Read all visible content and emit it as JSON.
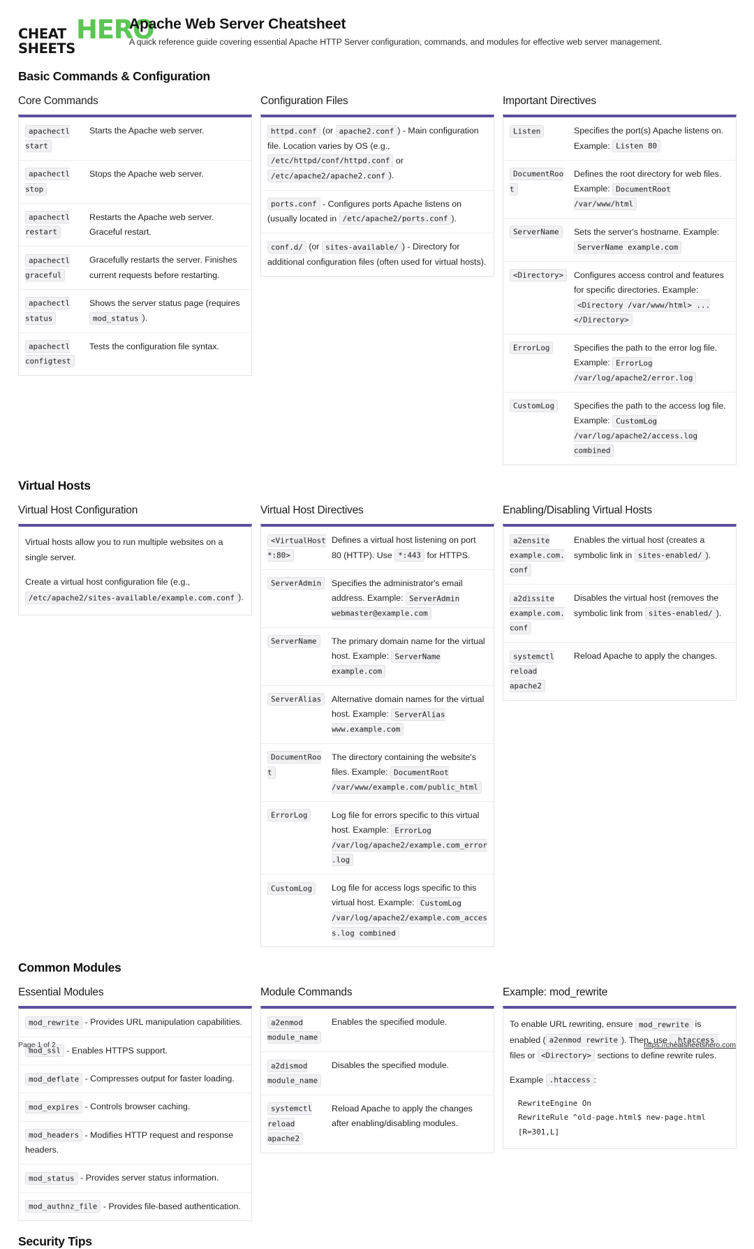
{
  "brand": {
    "logo_line1": "CHEAT",
    "logo_line2": "SHEETS",
    "logo_accent": "HERO",
    "accent_color": "#5bc653"
  },
  "header": {
    "title": "Apache Web Server Cheatsheet",
    "subtitle": "A quick reference guide covering essential Apache HTTP Server configuration, commands, and modules for effective web server management."
  },
  "theme": {
    "card_top_bar": "#5b4f9e",
    "code_bg": "#f1f1f3"
  },
  "sections": [
    {
      "title": "Basic Commands & Configuration",
      "cards": [
        {
          "title": "Core Commands",
          "rows": [
            {
              "term": "apachectl start",
              "desc": "Starts the Apache web server."
            },
            {
              "term": "apachectl stop",
              "desc": "Stops the Apache web server."
            },
            {
              "term": "apachectl restart",
              "desc": "Restarts the Apache web server. Graceful restart."
            },
            {
              "term": "apachectl graceful",
              "desc": "Gracefully restarts the server. Finishes current requests before restarting."
            },
            {
              "term": "apachectl status",
              "desc_pre": "Shows the server status page (requires ",
              "desc_code": "mod_status",
              "desc_post": ")."
            },
            {
              "term": "apachectl configtest",
              "desc": "Tests the configuration file syntax."
            }
          ]
        },
        {
          "title": "Configuration Files",
          "rows": [
            {
              "parts": [
                {
                  "t": "code",
                  "v": "httpd.conf"
                },
                {
                  "t": "text",
                  "v": " (or "
                },
                {
                  "t": "code",
                  "v": "apache2.conf"
                },
                {
                  "t": "text",
                  "v": ") - Main configuration file. Location varies by OS (e.g., "
                },
                {
                  "t": "code",
                  "v": "/etc/httpd/conf/httpd.conf"
                },
                {
                  "t": "text",
                  "v": " or "
                },
                {
                  "t": "code",
                  "v": "/etc/apache2/apache2.conf"
                },
                {
                  "t": "text",
                  "v": ")."
                }
              ]
            },
            {
              "parts": [
                {
                  "t": "code",
                  "v": "ports.conf"
                },
                {
                  "t": "text",
                  "v": " - Configures ports Apache listens on (usually located in "
                },
                {
                  "t": "code",
                  "v": "/etc/apache2/ports.conf"
                },
                {
                  "t": "text",
                  "v": ")."
                }
              ]
            },
            {
              "parts": [
                {
                  "t": "code",
                  "v": "conf.d/"
                },
                {
                  "t": "text",
                  "v": " (or "
                },
                {
                  "t": "code",
                  "v": "sites-available/"
                },
                {
                  "t": "text",
                  "v": ") - Directory for additional configuration files (often used for virtual hosts)."
                }
              ]
            }
          ]
        },
        {
          "title": "Important Directives",
          "rows": [
            {
              "term": "Listen",
              "desc_pre": "Specifies the port(s) Apache listens on. Example: ",
              "desc_code": "Listen 80",
              "desc_post": ""
            },
            {
              "term": "DocumentRoot",
              "desc_pre": "Defines the root directory for web files. Example: ",
              "desc_code": "DocumentRoot /var/www/html",
              "desc_post": ""
            },
            {
              "term": "ServerName",
              "desc_pre": "Sets the server's hostname. Example: ",
              "desc_code": "ServerName example.com",
              "desc_post": ""
            },
            {
              "term": "<Directory>",
              "desc_pre": "Configures access control and features for specific directories. Example: ",
              "desc_code": "<Directory /var/www/html> ... </Directory>",
              "desc_post": ""
            },
            {
              "term": "ErrorLog",
              "desc_pre": "Specifies the path to the error log file. Example: ",
              "desc_code": "ErrorLog /var/log/apache2/error.log",
              "desc_post": ""
            },
            {
              "term": "CustomLog",
              "desc_pre": "Specifies the path to the access log file. Example: ",
              "desc_code": "CustomLog /var/log/apache2/access.log combined",
              "desc_post": ""
            }
          ]
        }
      ]
    },
    {
      "title": "Virtual Hosts",
      "cards": [
        {
          "title": "Virtual Host Configuration",
          "prose": [
            {
              "parts": [
                {
                  "t": "text",
                  "v": "Virtual hosts allow you to run multiple websites on a single server."
                }
              ]
            },
            {
              "parts": [
                {
                  "t": "text",
                  "v": "Create a virtual host configuration file (e.g., "
                },
                {
                  "t": "code",
                  "v": "/etc/apache2/sites-available/example.com.conf"
                },
                {
                  "t": "text",
                  "v": ")."
                }
              ]
            }
          ]
        },
        {
          "title": "Virtual Host Directives",
          "rows": [
            {
              "term": "<VirtualHost *:80>",
              "desc_pre": "Defines a virtual host listening on port 80 (HTTP). Use ",
              "desc_code": "*:443",
              "desc_post": " for HTTPS."
            },
            {
              "term": "ServerAdmin",
              "desc_pre": "Specifies the administrator's email address. Example: ",
              "desc_code": "ServerAdmin webmaster@example.com",
              "desc_post": ""
            },
            {
              "term": "ServerName",
              "desc_pre": "The primary domain name for the virtual host. Example: ",
              "desc_code": "ServerName example.com",
              "desc_post": ""
            },
            {
              "term": "ServerAlias",
              "desc_pre": "Alternative domain names for the virtual host. Example: ",
              "desc_code": "ServerAlias www.example.com",
              "desc_post": ""
            },
            {
              "term": "DocumentRoot",
              "desc_pre": "The directory containing the website's files. Example: ",
              "desc_code": "DocumentRoot /var/www/example.com/public_html",
              "desc_post": ""
            },
            {
              "term": "ErrorLog",
              "desc_pre": "Log file for errors specific to this virtual host. Example: ",
              "desc_code": "ErrorLog /var/log/apache2/example.com_error.log",
              "desc_post": ""
            },
            {
              "term": "CustomLog",
              "desc_pre": "Log file for access logs specific to this virtual host. Example: ",
              "desc_code": "CustomLog /var/log/apache2/example.com_access.log combined",
              "desc_post": ""
            }
          ]
        },
        {
          "title": "Enabling/Disabling Virtual Hosts",
          "rows": [
            {
              "term": "a2ensite example.com.conf",
              "desc_pre": "Enables the virtual host (creates a symbolic link in ",
              "desc_code": "sites-enabled/",
              "desc_post": ")."
            },
            {
              "term": "a2dissite example.com.conf",
              "desc_pre": "Disables the virtual host (removes the symbolic link from ",
              "desc_code": "sites-enabled/",
              "desc_post": ")."
            },
            {
              "term": "systemctl reload apache2",
              "desc": "Reload Apache to apply the changes."
            }
          ]
        }
      ]
    },
    {
      "title": "Common Modules",
      "cards": [
        {
          "title": "Essential Modules",
          "rows": [
            {
              "parts": [
                {
                  "t": "code",
                  "v": "mod_rewrite"
                },
                {
                  "t": "text",
                  "v": " - Provides URL manipulation capabilities."
                }
              ]
            },
            {
              "parts": [
                {
                  "t": "code",
                  "v": "mod_ssl"
                },
                {
                  "t": "text",
                  "v": " - Enables HTTPS support."
                }
              ]
            },
            {
              "parts": [
                {
                  "t": "code",
                  "v": "mod_deflate"
                },
                {
                  "t": "text",
                  "v": " - Compresses output for faster loading."
                }
              ]
            },
            {
              "parts": [
                {
                  "t": "code",
                  "v": "mod_expires"
                },
                {
                  "t": "text",
                  "v": " - Controls browser caching."
                }
              ]
            },
            {
              "parts": [
                {
                  "t": "code",
                  "v": "mod_headers"
                },
                {
                  "t": "text",
                  "v": " - Modifies HTTP request and response headers."
                }
              ]
            },
            {
              "parts": [
                {
                  "t": "code",
                  "v": "mod_status"
                },
                {
                  "t": "text",
                  "v": " - Provides server status information."
                }
              ]
            },
            {
              "parts": [
                {
                  "t": "code",
                  "v": "mod_authnz_file"
                },
                {
                  "t": "text",
                  "v": " - Provides file-based authentication."
                }
              ]
            }
          ]
        },
        {
          "title": "Module Commands",
          "rows": [
            {
              "term": "a2enmod module_name",
              "desc": "Enables the specified module."
            },
            {
              "term": "a2dismod module_name",
              "desc": "Disables the specified module."
            },
            {
              "term": "systemctl reload apache2",
              "desc": "Reload Apache to apply the changes after enabling/disabling modules."
            }
          ]
        },
        {
          "title": "Example: mod_rewrite",
          "prose": [
            {
              "parts": [
                {
                  "t": "text",
                  "v": "To enable URL rewriting, ensure "
                },
                {
                  "t": "code",
                  "v": "mod_rewrite"
                },
                {
                  "t": "text",
                  "v": " is enabled ("
                },
                {
                  "t": "code",
                  "v": "a2enmod rewrite"
                },
                {
                  "t": "text",
                  "v": "). Then, use "
                },
                {
                  "t": "code",
                  "v": ".htaccess"
                },
                {
                  "t": "text",
                  "v": " files or "
                },
                {
                  "t": "code",
                  "v": "<Directory>"
                },
                {
                  "t": "text",
                  "v": " sections to define rewrite rules."
                }
              ]
            },
            {
              "parts": [
                {
                  "t": "text",
                  "v": "Example "
                },
                {
                  "t": "code",
                  "v": ".htaccess"
                },
                {
                  "t": "text",
                  "v": ":"
                }
              ]
            }
          ],
          "codeblock": "RewriteEngine On\nRewriteRule ^old-page.html$ new-page.html\n[R=301,L]"
        }
      ]
    },
    {
      "title": "Security Tips",
      "cards": []
    }
  ],
  "footer": {
    "page_label": "Page 1 of 2",
    "url": "https://cheatsheetshero.com"
  }
}
